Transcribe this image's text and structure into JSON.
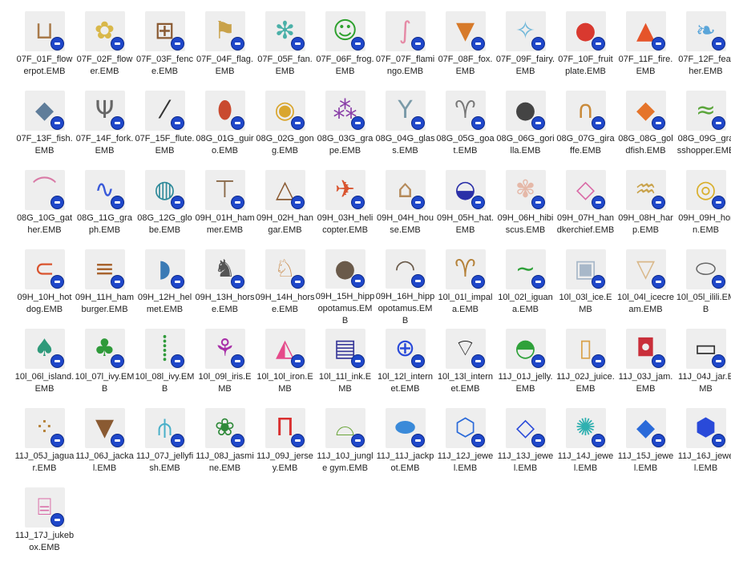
{
  "files": [
    {
      "name": "07F_01F_flowerpot.EMB",
      "icon": "flowerpot-icon",
      "glyph": "⊔",
      "color": "#a87a4a"
    },
    {
      "name": "07F_02F_flower.EMB",
      "icon": "flower-icon",
      "glyph": "✿",
      "color": "#d9b84a"
    },
    {
      "name": "07F_03F_fence.EMB",
      "icon": "fence-icon",
      "glyph": "⊞",
      "color": "#8a5a32"
    },
    {
      "name": "07F_04F_flag.EMB",
      "icon": "flag-icon",
      "glyph": "⚑",
      "color": "#c9a24a"
    },
    {
      "name": "07F_05F_fan.EMB",
      "icon": "fan-icon",
      "glyph": "✻",
      "color": "#4ab0a8"
    },
    {
      "name": "07F_06F_frog.EMB",
      "icon": "frog-icon",
      "glyph": "☺",
      "color": "#2fa12f"
    },
    {
      "name": "07F_07F_flamingo.EMB",
      "icon": "flamingo-icon",
      "glyph": "∫",
      "color": "#e58aa6"
    },
    {
      "name": "07F_08F_fox.EMB",
      "icon": "fox-icon",
      "glyph": "▼",
      "color": "#d77a2a"
    },
    {
      "name": "07F_09F_fairy.EMB",
      "icon": "fairy-icon",
      "glyph": "✧",
      "color": "#6fb7d9"
    },
    {
      "name": "07F_10F_fruit plate.EMB",
      "icon": "fruit-plate-icon",
      "glyph": "●",
      "color": "#d9392f"
    },
    {
      "name": "07F_11F_fire.EMB",
      "icon": "fire-icon",
      "glyph": "▲",
      "color": "#e5542a"
    },
    {
      "name": "07F_12F_feather.EMB",
      "icon": "feather-icon",
      "glyph": "❧",
      "color": "#5aa5d9"
    },
    {
      "name": "07F_13F_fish.EMB",
      "icon": "fish-icon",
      "glyph": "◆",
      "color": "#5f7d9a"
    },
    {
      "name": "07F_14F_fork.EMB",
      "icon": "fork-icon",
      "glyph": "Ψ",
      "color": "#666666"
    },
    {
      "name": "07F_15F_flute.EMB",
      "icon": "flute-icon",
      "glyph": "⁄",
      "color": "#333333"
    },
    {
      "name": "08G_01G_guiro.EMB",
      "icon": "guiro-icon",
      "glyph": "⬮",
      "color": "#c94a2f"
    },
    {
      "name": "08G_02G_gong.EMB",
      "icon": "gong-icon",
      "glyph": "◉",
      "color": "#d9a62f"
    },
    {
      "name": "08G_03G_grape.EMB",
      "icon": "grape-icon",
      "glyph": "⁂",
      "color": "#8a3fa8"
    },
    {
      "name": "08G_04G_glass.EMB",
      "icon": "glass-icon",
      "glyph": "Y",
      "color": "#7a9aa8"
    },
    {
      "name": "08G_05G_goat.EMB",
      "icon": "goat-icon",
      "glyph": "♈",
      "color": "#777777"
    },
    {
      "name": "08G_06G_gorilla.EMB",
      "icon": "gorilla-icon",
      "glyph": "●",
      "color": "#444444"
    },
    {
      "name": "08G_07G_giraffe.EMB",
      "icon": "giraffe-icon",
      "glyph": "∩",
      "color": "#c98a3a"
    },
    {
      "name": "08G_08G_goldfish.EMB",
      "icon": "goldfish-icon",
      "glyph": "◆",
      "color": "#e5742a"
    },
    {
      "name": "08G_09G_grasshopper.EMB",
      "icon": "grasshopper-icon",
      "glyph": "≈",
      "color": "#5aa53a"
    },
    {
      "name": "08G_10G_gather.EMB",
      "icon": "gather-icon",
      "glyph": "⌒",
      "color": "#d97aa6"
    },
    {
      "name": "08G_11G_graph.EMB",
      "icon": "graph-icon",
      "glyph": "∿",
      "color": "#3a5ad9"
    },
    {
      "name": "08G_12G_globe.EMB",
      "icon": "globe-icon",
      "glyph": "◍",
      "color": "#2f8a9a"
    },
    {
      "name": "09H_01H_hammer.EMB",
      "icon": "hammer-icon",
      "glyph": "⊤",
      "color": "#8a6a4a"
    },
    {
      "name": "09H_02H_hangar.EMB",
      "icon": "hanger-icon",
      "glyph": "△",
      "color": "#8a5a32"
    },
    {
      "name": "09H_03H_helicopter.EMB",
      "icon": "helicopter-icon",
      "glyph": "✈",
      "color": "#d9542f"
    },
    {
      "name": "09H_04H_house.EMB",
      "icon": "house-icon",
      "glyph": "⌂",
      "color": "#b58a5a"
    },
    {
      "name": "09H_05H_hat.EMB",
      "icon": "hat-icon",
      "glyph": "◒",
      "color": "#2a2fa8"
    },
    {
      "name": "09H_06H_hibiscus.EMB",
      "icon": "hibiscus-icon",
      "glyph": "✾",
      "color": "#e5b8a8"
    },
    {
      "name": "09H_07H_handkerchief.EMB",
      "icon": "handkerchief-icon",
      "glyph": "◇",
      "color": "#d96aa6"
    },
    {
      "name": "09H_08H_harp.EMB",
      "icon": "harp-icon",
      "glyph": "♒",
      "color": "#c9a24a"
    },
    {
      "name": "09H_09H_horn.EMB",
      "icon": "horn-icon",
      "glyph": "◎",
      "color": "#d9b02f"
    },
    {
      "name": "09H_10H_hot dog.EMB",
      "icon": "hot-dog-icon",
      "glyph": "⊂",
      "color": "#d9542f"
    },
    {
      "name": "09H_11H_hamburger.EMB",
      "icon": "hamburger-icon",
      "glyph": "≡",
      "color": "#a8642f"
    },
    {
      "name": "09H_12H_helmet.EMB",
      "icon": "helmet-icon",
      "glyph": "◗",
      "color": "#3a7ab5"
    },
    {
      "name": "09H_13H_horse.EMB",
      "icon": "horse-icon",
      "glyph": "♞",
      "color": "#555555"
    },
    {
      "name": "09H_14H_horse.EMB",
      "icon": "horse-icon",
      "glyph": "♘",
      "color": "#c98a4a"
    },
    {
      "name": "09H_15H_hippopotamus.EMB",
      "icon": "hippopotamus-icon",
      "glyph": "●",
      "color": "#6a5a4a"
    },
    {
      "name": "09H_16H_hippopotamus.EMB",
      "icon": "hippopotamus-icon",
      "glyph": "◠",
      "color": "#6a5a4a"
    },
    {
      "name": "10l_01l_impala.EMB",
      "icon": "impala-icon",
      "glyph": "♈",
      "color": "#b5823a"
    },
    {
      "name": "10l_02l_iguana.EMB",
      "icon": "iguana-icon",
      "glyph": "∼",
      "color": "#2fa13a"
    },
    {
      "name": "10l_03l_ice.EMB",
      "icon": "ice-icon",
      "glyph": "▣",
      "color": "#a8b8c9"
    },
    {
      "name": "10l_04l_icecream.EMB",
      "icon": "icecream-icon",
      "glyph": "▽",
      "color": "#d9b88a"
    },
    {
      "name": "10l_05l_ilili.EMB",
      "icon": "ilili-icon",
      "glyph": "⬭",
      "color": "#666666"
    },
    {
      "name": "10l_06l_island.EMB",
      "icon": "island-icon",
      "glyph": "♠",
      "color": "#2f9a7a"
    },
    {
      "name": "10l_07l_ivy.EMB",
      "icon": "ivy-icon",
      "glyph": "♣",
      "color": "#2f9a3a"
    },
    {
      "name": "10l_08l_ivy.EMB",
      "icon": "ivy-icon",
      "glyph": "⸽",
      "color": "#2f9a3a"
    },
    {
      "name": "10l_09l_iris.EMB",
      "icon": "iris-icon",
      "glyph": "⚘",
      "color": "#a82fa8"
    },
    {
      "name": "10l_10l_iron.EMB",
      "icon": "iron-icon",
      "glyph": "◭",
      "color": "#e54a8a"
    },
    {
      "name": "10l_11l_ink.EMB",
      "icon": "ink-icon",
      "glyph": "▤",
      "color": "#3a3a9a"
    },
    {
      "name": "10l_12l_internet.EMB",
      "icon": "internet-icon",
      "glyph": "⊕",
      "color": "#2a4ad9"
    },
    {
      "name": "10l_13l_internet.EMB",
      "icon": "wifi-icon",
      "glyph": "⌔",
      "color": "#222222"
    },
    {
      "name": "11J_01J_jelly.EMB",
      "icon": "jelly-icon",
      "glyph": "◓",
      "color": "#2fa13a"
    },
    {
      "name": "11J_02J_juice.EMB",
      "icon": "juice-icon",
      "glyph": "▯",
      "color": "#d9a24a"
    },
    {
      "name": "11J_03J_jam.EMB",
      "icon": "jam-icon",
      "glyph": "◘",
      "color": "#c92f3a"
    },
    {
      "name": "11J_04J_jar.EMB",
      "icon": "jar-icon",
      "glyph": "▭",
      "color": "#333333"
    },
    {
      "name": "11J_05J_jaguar.EMB",
      "icon": "jaguar-icon",
      "glyph": "⁘",
      "color": "#b5823a"
    },
    {
      "name": "11J_06J_jackal.EMB",
      "icon": "jackal-icon",
      "glyph": "▼",
      "color": "#8a5a32"
    },
    {
      "name": "11J_07J_jellyfish.EMB",
      "icon": "jellyfish-icon",
      "glyph": "⫛",
      "color": "#4ab0c9"
    },
    {
      "name": "11J_08J_jasmine.EMB",
      "icon": "jasmine-icon",
      "glyph": "❀",
      "color": "#2f8a3a"
    },
    {
      "name": "11J_09J_jersey.EMB",
      "icon": "jersey-icon",
      "glyph": "Π",
      "color": "#d92f2f"
    },
    {
      "name": "11J_10J_jungle gym.EMB",
      "icon": "jungle-gym-icon",
      "glyph": "⌓",
      "color": "#6aa53a"
    },
    {
      "name": "11J_11J_jackpot.EMB",
      "icon": "jackpot-icon",
      "glyph": "⬬",
      "color": "#3a8ad9"
    },
    {
      "name": "11J_12J_jewel.EMB",
      "icon": "jewel-icon",
      "glyph": "⬡",
      "color": "#2a6ad9"
    },
    {
      "name": "11J_13J_jewel.EMB",
      "icon": "jewel-icon",
      "glyph": "◇",
      "color": "#2a4ad9"
    },
    {
      "name": "11J_14J_jewel.EMB",
      "icon": "jewel-icon",
      "glyph": "✺",
      "color": "#2fb0b0"
    },
    {
      "name": "11J_15J_jewel.EMB",
      "icon": "jewel-icon",
      "glyph": "◆",
      "color": "#2a6ad9"
    },
    {
      "name": "11J_16J_jewel.EMB",
      "icon": "jewel-icon",
      "glyph": "⬢",
      "color": "#2a4ad9"
    },
    {
      "name": "11J_17J_jukebox.EMB",
      "icon": "jukebox-icon",
      "glyph": "⌸",
      "color": "#d96aa6"
    }
  ]
}
